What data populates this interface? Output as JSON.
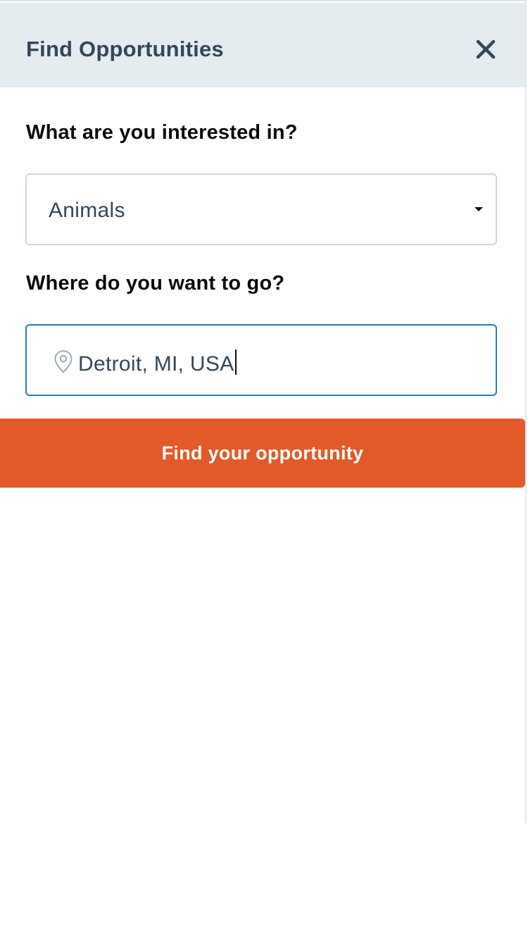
{
  "header": {
    "title": "Find Opportunities",
    "close_icon": "close-icon"
  },
  "interest": {
    "label": "What are you interested in?",
    "selected_value": "Animals",
    "dropdown_icon": "caret-down-icon"
  },
  "location": {
    "label": "Where do you want to go?",
    "value": "Detroit, MI, USA",
    "icon": "map-pin-icon"
  },
  "submit": {
    "label": "Find your opportunity"
  },
  "colors": {
    "header_bg": "#e5ecf0",
    "header_text": "#33475b",
    "cta_bg": "#e15a28",
    "input_focus_border": "#1f7fbf",
    "select_border": "#cbd6e2"
  }
}
